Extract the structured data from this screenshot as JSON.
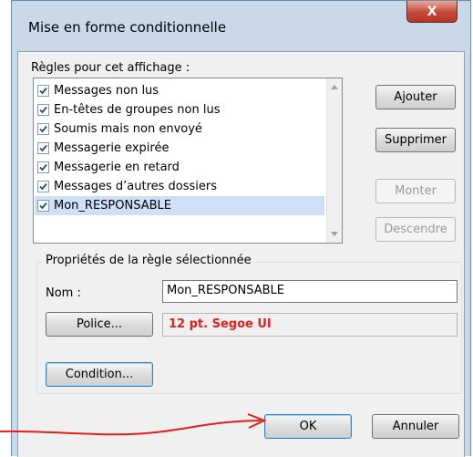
{
  "window": {
    "title": "Mise en forme conditionnelle",
    "close_label": "X"
  },
  "rules": {
    "label": "Règles pour cet affichage :",
    "items": [
      {
        "label": "Messages non lus",
        "checked": true
      },
      {
        "label": "En-têtes de groupes non lus",
        "checked": true
      },
      {
        "label": "Soumis mais non envoyé",
        "checked": true
      },
      {
        "label": "Messagerie expirée",
        "checked": true
      },
      {
        "label": "Messagerie en retard",
        "checked": true
      },
      {
        "label": "Messages d’autres dossiers",
        "checked": true
      },
      {
        "label": "Mon_RESPONSABLE",
        "checked": true,
        "selected": true
      }
    ]
  },
  "buttons": {
    "add": "Ajouter",
    "delete": "Supprimer",
    "up": "Monter",
    "down": "Descendre",
    "font": "Police...",
    "condition": "Condition...",
    "ok": "OK",
    "cancel": "Annuler"
  },
  "properties": {
    "group_title": "Propriétés de la règle sélectionnée",
    "name_label": "Nom :",
    "name_value": "Mon_RESPONSABLE",
    "font_value": "12 pt. Segoe UI"
  },
  "colors": {
    "accent": "#3c7fb1",
    "font_preview": "#e0201c",
    "annotation_arrow": "#e0201c",
    "selection": "#cde0f7"
  }
}
